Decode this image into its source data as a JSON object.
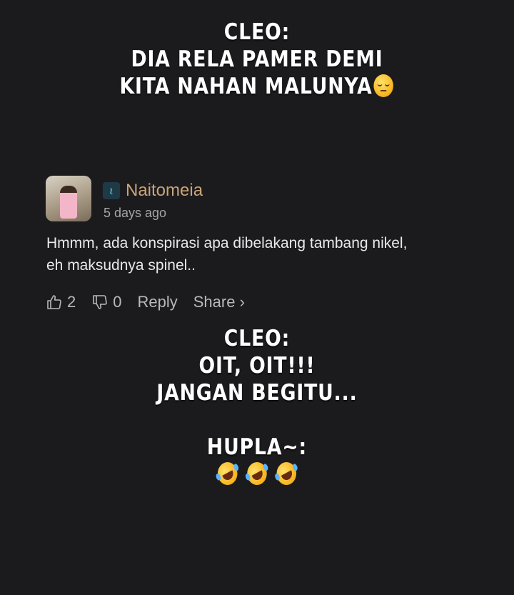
{
  "caption_top": {
    "line1": "CLEO:",
    "line2": "DIA RELA PAMER DEMI",
    "line3": "KITA NAHAN MALUNYA",
    "emoji": "pensive-face-emoji"
  },
  "comment": {
    "username": "Naitomeia",
    "badge_icon": "creator-badge-icon",
    "timestamp": "5 days ago",
    "text_line1": "Hmmm, ada konspirasi apa dibelakang tambang nikel,",
    "text_line2": "eh maksudnya spinel..",
    "likes": "2",
    "dislikes": "0",
    "reply_label": "Reply",
    "share_label": "Share ›",
    "colors": {
      "username": "#c9a57a",
      "background": "#1b1b1d"
    }
  },
  "caption_bottom": {
    "line1": "CLEO:",
    "line2": "OIT, OIT!!!",
    "line3": "JANGAN BEGITU...",
    "line4": "HUPLA~:",
    "emojis": [
      "rofl-emoji",
      "rofl-emoji",
      "rofl-emoji"
    ]
  }
}
